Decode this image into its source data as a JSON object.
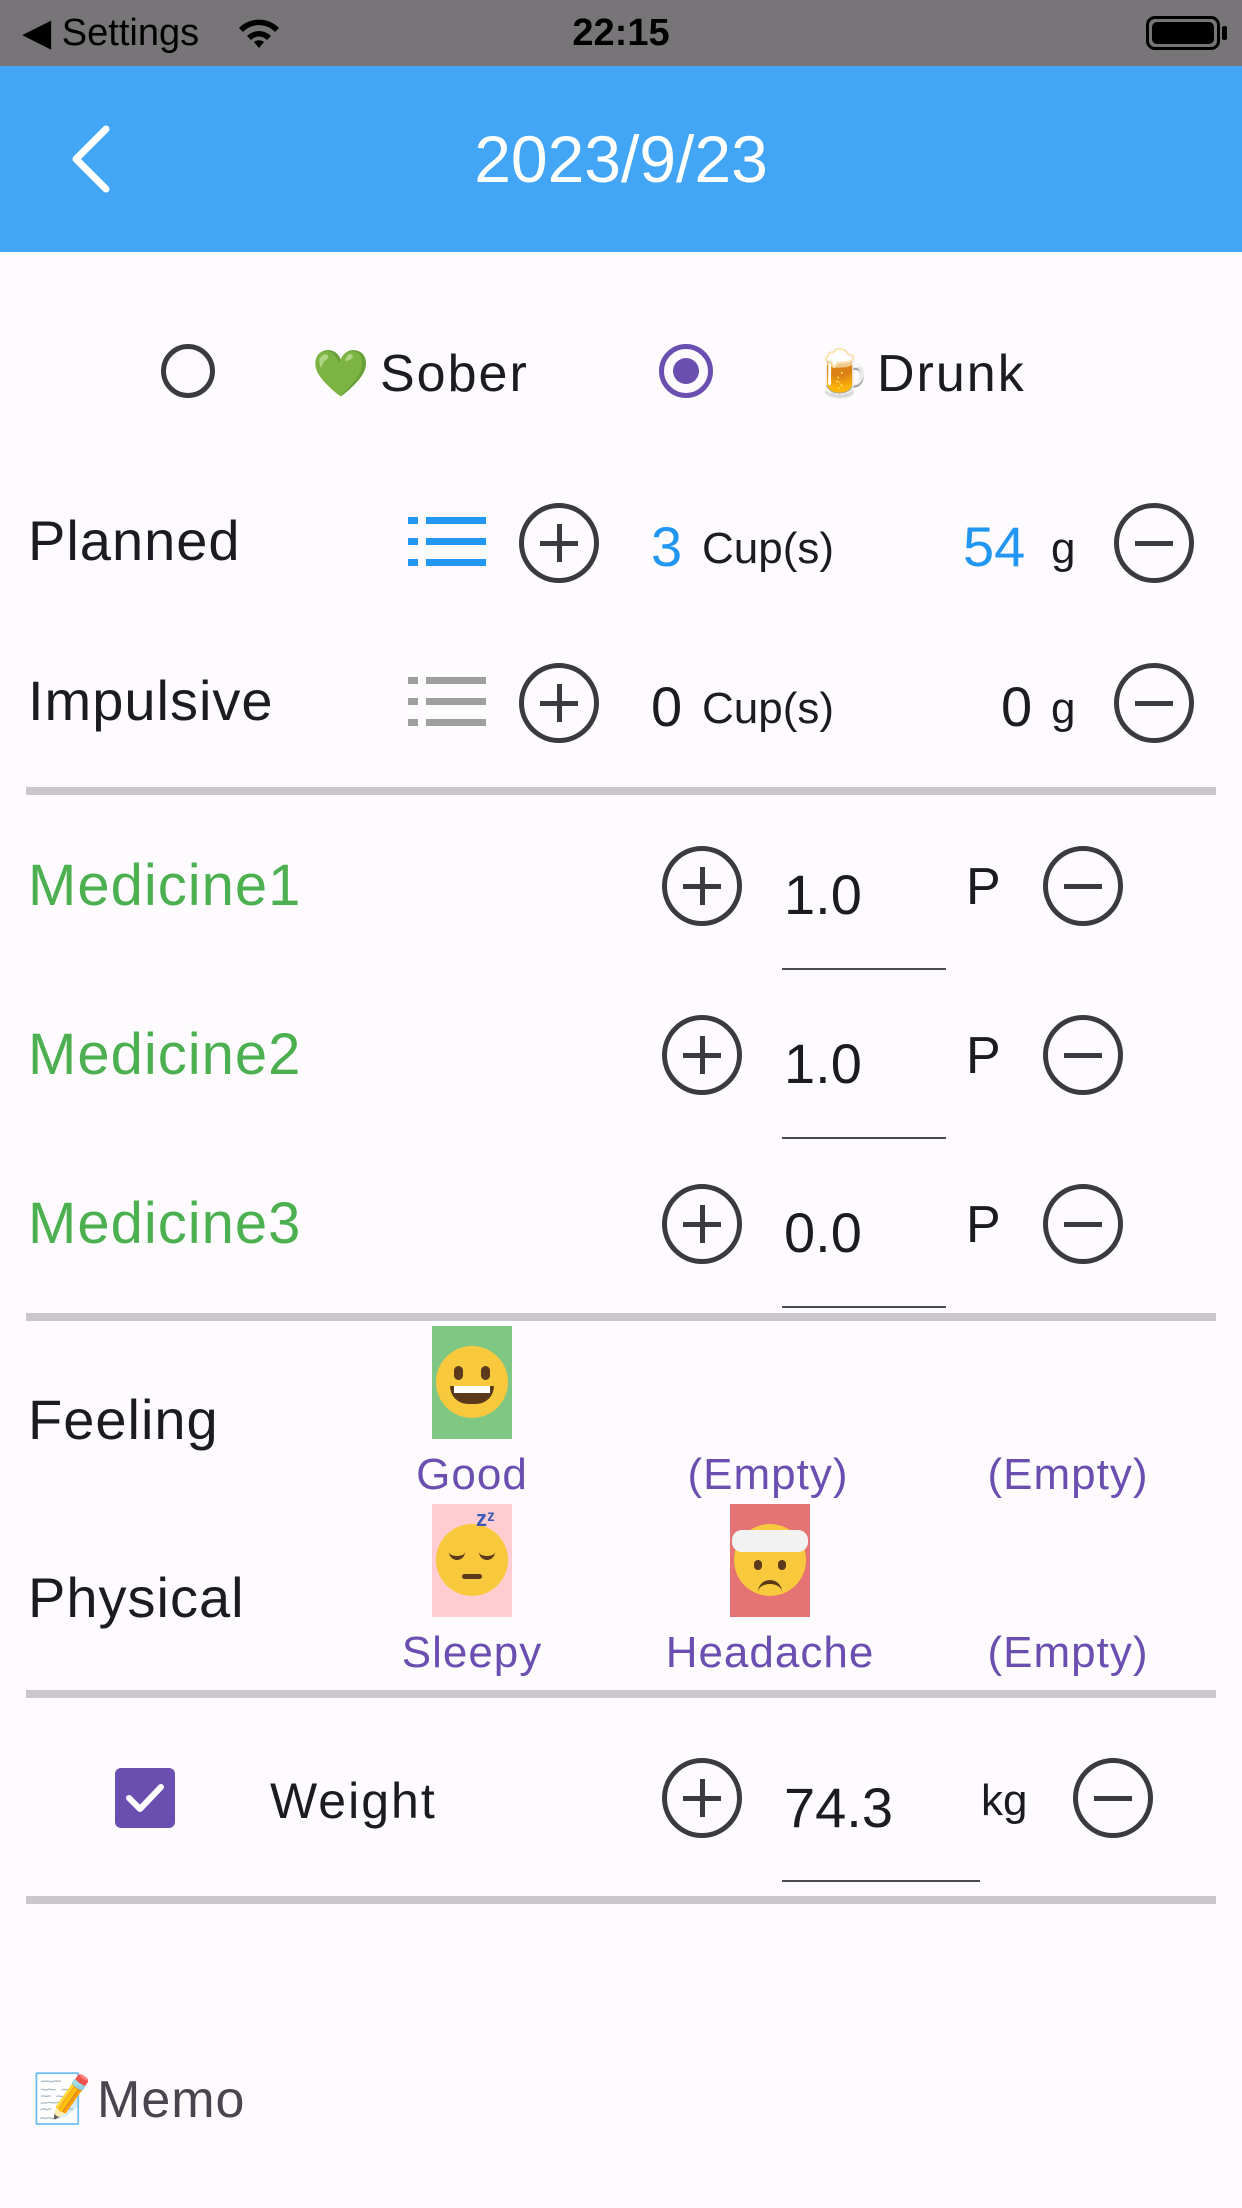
{
  "status_bar": {
    "back_app": "◀ Settings",
    "time": "22:15"
  },
  "header": {
    "title": "2023/9/23"
  },
  "mode": {
    "options": [
      {
        "label": "Sober",
        "emoji": "💚",
        "selected": false
      },
      {
        "label": "Drunk",
        "emoji": "🍺",
        "selected": true
      }
    ]
  },
  "drinks": {
    "planned": {
      "label": "Planned",
      "cups": "3",
      "cups_unit": "Cup(s)",
      "grams": "54",
      "grams_unit": "g"
    },
    "impulsive": {
      "label": "Impulsive",
      "cups": "0",
      "cups_unit": "Cup(s)",
      "grams": "0",
      "grams_unit": "g"
    }
  },
  "medicines": [
    {
      "label": "Medicine1",
      "value": "1.0",
      "unit": "P"
    },
    {
      "label": "Medicine2",
      "value": "1.0",
      "unit": "P"
    },
    {
      "label": "Medicine3",
      "value": "0.0",
      "unit": "P"
    }
  ],
  "feeling": {
    "label": "Feeling",
    "tags": [
      {
        "label": "Good",
        "icon": "grinning-face-icon",
        "bg": "#81c784"
      },
      {
        "label": "(Empty)"
      },
      {
        "label": "(Empty)"
      }
    ]
  },
  "physical": {
    "label": "Physical",
    "tags": [
      {
        "label": "Sleepy",
        "icon": "sleepy-face-icon",
        "bg": "#ffcdd2"
      },
      {
        "label": "Headache",
        "icon": "bandaged-head-icon",
        "bg": "#e57373"
      },
      {
        "label": "(Empty)"
      }
    ]
  },
  "weight": {
    "label": "Weight",
    "value": "74.3",
    "unit": "kg",
    "checked": true
  },
  "memo": {
    "emoji": "📝",
    "label": "Memo"
  },
  "colors": {
    "appbar": "#42a5f5",
    "accent": "#6a4fb1",
    "medicine": "#4caf50",
    "value_blue": "#2196f3"
  }
}
